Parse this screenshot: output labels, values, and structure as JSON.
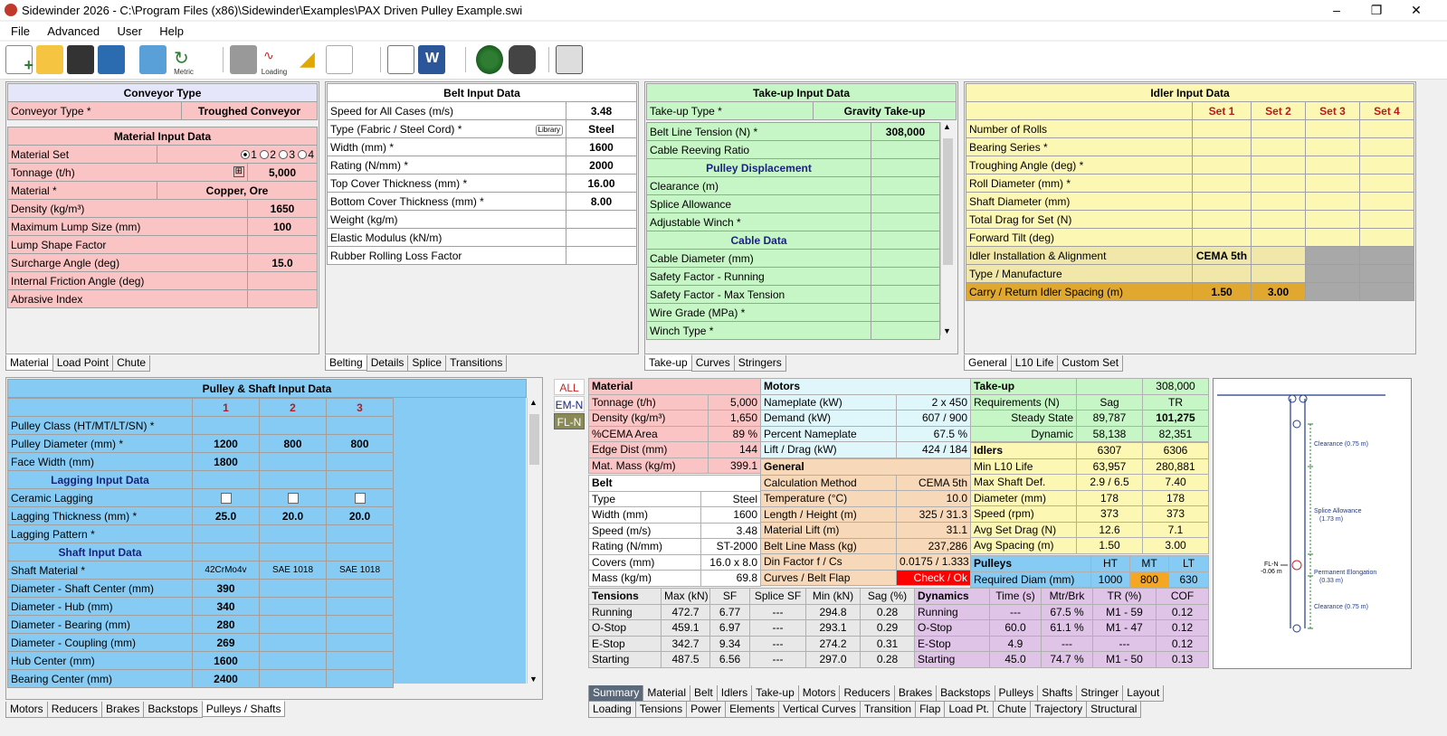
{
  "title": "Sidewinder 2026 - C:\\Program Files (x86)\\Sidewinder\\Examples\\PAX Driven Pulley Example.swi",
  "menu": [
    "File",
    "Advanced",
    "User",
    "Help"
  ],
  "toolbar": {
    "loading_label": "Loading",
    "metric_label": "Metric"
  },
  "conveyor": {
    "header": "Conveyor Type",
    "type_label": "Conveyor Type *",
    "type_value": "Troughed Conveyor"
  },
  "material": {
    "header": "Material Input Data",
    "set_label": "Material Set",
    "sets": [
      "1",
      "2",
      "3",
      "4"
    ],
    "tonnage_label": "Tonnage (t/h)",
    "tonnage": "5,000",
    "material_label": "Material *",
    "material_value": "Copper, Ore",
    "rows": [
      {
        "label": "Density (kg/m³)",
        "value": "1650"
      },
      {
        "label": "Maximum Lump Size (mm)",
        "value": "100"
      },
      {
        "label": "Lump Shape Factor",
        "value": ""
      },
      {
        "label": "Surcharge Angle (deg)",
        "value": "15.0"
      },
      {
        "label": "Internal Friction Angle (deg)",
        "value": ""
      },
      {
        "label": "Abrasive Index",
        "value": ""
      }
    ],
    "tabs": [
      "Material",
      "Load Point",
      "Chute"
    ]
  },
  "belt": {
    "header": "Belt Input Data",
    "speed_label": "Speed for All Cases (m/s)",
    "speed": "3.48",
    "type_label": "Type (Fabric / Steel Cord) *",
    "library_label": "Library",
    "type_value": "Steel",
    "rows": [
      {
        "label": "Width (mm) *",
        "value": "1600"
      },
      {
        "label": "Rating (N/mm) *",
        "value": "2000"
      },
      {
        "label": "Top Cover Thickness (mm) *",
        "value": "16.00"
      },
      {
        "label": "Bottom Cover Thickness (mm) *",
        "value": "8.00"
      },
      {
        "label": "Weight (kg/m)",
        "value": ""
      },
      {
        "label": "Elastic Modulus (kN/m)",
        "value": ""
      },
      {
        "label": "Rubber Rolling Loss Factor",
        "value": ""
      }
    ],
    "tabs": [
      "Belting",
      "Details",
      "Splice",
      "Transitions"
    ]
  },
  "takeup": {
    "header": "Take-up Input Data",
    "type_label": "Take-up Type *",
    "type_value": "Gravity Take-up",
    "rows": [
      {
        "label": "Belt Line Tension (N) *",
        "value": "308,000",
        "sub": false
      },
      {
        "label": "Cable Reeving Ratio",
        "value": "",
        "sub": false
      },
      {
        "label": "Pulley Displacement",
        "value": "",
        "sub": true
      },
      {
        "label": "Clearance (m)",
        "value": "",
        "sub": false
      },
      {
        "label": "Splice Allowance",
        "value": "",
        "sub": false
      },
      {
        "label": "Adjustable Winch *",
        "value": "",
        "sub": false
      },
      {
        "label": "Cable Data",
        "value": "",
        "sub": true
      },
      {
        "label": "Cable Diameter (mm)",
        "value": "",
        "sub": false
      },
      {
        "label": "Safety Factor - Running",
        "value": "",
        "sub": false
      },
      {
        "label": "Safety Factor - Max Tension",
        "value": "",
        "sub": false
      },
      {
        "label": "Wire Grade (MPa) *",
        "value": "",
        "sub": false
      },
      {
        "label": "Winch Type *",
        "value": "",
        "sub": false
      }
    ],
    "tabs": [
      "Take-up",
      "Curves",
      "Stringers"
    ]
  },
  "idler": {
    "header": "Idler Input Data",
    "sets": [
      "Set 1",
      "Set 2",
      "Set 3",
      "Set 4"
    ],
    "rows": [
      "Number of Rolls",
      "Bearing Series *",
      "Troughing Angle (deg) *",
      "Roll Diameter (mm) *",
      "Shaft Diameter (mm)",
      "Total Drag for Set (N)",
      "Forward Tilt (deg)"
    ],
    "install_label": "Idler Installation & Alignment",
    "install_value": "CEMA 5th",
    "type_label": "Type / Manufacture",
    "spacing_label": "Carry / Return Idler Spacing (m)",
    "spacing": [
      "1.50",
      "3.00"
    ],
    "tabs": [
      "General",
      "L10 Life",
      "Custom Set"
    ]
  },
  "pulley": {
    "header": "Pulley & Shaft Input Data",
    "cols": [
      "1",
      "2",
      "3"
    ],
    "rows": [
      {
        "label": "Pulley Class (HT/MT/LT/SN) *",
        "v": [
          "",
          "",
          ""
        ],
        "sub": false
      },
      {
        "label": "Pulley Diameter (mm) *",
        "v": [
          "1200",
          "800",
          "800"
        ],
        "sub": false
      },
      {
        "label": "Face Width (mm)",
        "v": [
          "1800",
          "",
          ""
        ],
        "sub": false
      },
      {
        "label": "Lagging Input Data",
        "v": [],
        "sub": true
      },
      {
        "label": "Ceramic Lagging",
        "v": [
          "chk",
          "chk",
          "chk"
        ],
        "sub": false
      },
      {
        "label": "Lagging Thickness (mm) *",
        "v": [
          "25.0",
          "20.0",
          "20.0"
        ],
        "sub": false
      },
      {
        "label": "Lagging Pattern *",
        "v": [
          "",
          "",
          ""
        ],
        "sub": false
      },
      {
        "label": "Shaft Input Data",
        "v": [],
        "sub": true
      },
      {
        "label": "Shaft Material *",
        "v": [
          "42CrMo4v",
          "SAE 1018",
          "SAE 1018"
        ],
        "sub": false,
        "small": true
      },
      {
        "label": "Diameter - Shaft Center (mm)",
        "v": [
          "390",
          "",
          ""
        ],
        "sub": false
      },
      {
        "label": "Diameter - Hub (mm)",
        "v": [
          "340",
          "",
          ""
        ],
        "sub": false
      },
      {
        "label": "Diameter - Bearing (mm)",
        "v": [
          "280",
          "",
          ""
        ],
        "sub": false
      },
      {
        "label": "Diameter - Coupling (mm)",
        "v": [
          "269",
          "",
          ""
        ],
        "sub": false
      },
      {
        "label": "Hub Center (mm)",
        "v": [
          "1600",
          "",
          ""
        ],
        "sub": false
      },
      {
        "label": "Bearing Center (mm)",
        "v": [
          "2400",
          "",
          ""
        ],
        "sub": false
      }
    ],
    "tabs": [
      "Motors",
      "Reducers",
      "Brakes",
      "Backstops",
      "Pulleys / Shafts"
    ]
  },
  "modes": [
    "ALL",
    "EM-N",
    "FL-N"
  ],
  "summary": {
    "material": {
      "header": "Material",
      "rows": [
        [
          "Tonnage (t/h)",
          "5,000"
        ],
        [
          "Density (kg/m³)",
          "1,650"
        ],
        [
          "%CEMA Area",
          "89 %"
        ],
        [
          "Edge Dist (mm)",
          "144"
        ],
        [
          "Mat. Mass (kg/m)",
          "399.1"
        ]
      ]
    },
    "belt": {
      "header": "Belt",
      "rows": [
        [
          "Type",
          "Steel"
        ],
        [
          "Width (mm)",
          "1600"
        ],
        [
          "Speed (m/s)",
          "3.48"
        ],
        [
          "Rating (N/mm)",
          "ST-2000"
        ],
        [
          "Covers (mm)",
          "16.0 x 8.0"
        ],
        [
          "Mass (kg/m)",
          "69.8"
        ]
      ]
    },
    "motors": {
      "header": "Motors",
      "rows": [
        [
          "Nameplate (kW)",
          "2 x 450"
        ],
        [
          "Demand (kW)",
          "607 / 900"
        ],
        [
          "Percent Nameplate",
          "67.5 %"
        ],
        [
          "Lift / Drag (kW)",
          "424 / 184"
        ]
      ]
    },
    "general": {
      "header": "General",
      "rows": [
        [
          "Calculation Method",
          "CEMA 5th"
        ],
        [
          "Temperature (°C)",
          "10.0"
        ],
        [
          "Length / Height (m)",
          "325 / 31.3"
        ],
        [
          "Material Lift (m)",
          "31.1"
        ],
        [
          "Belt Line Mass (kg)",
          "237,286"
        ],
        [
          "Din Factor f / Cs",
          "0.0175 / 1.333"
        ],
        [
          "Curves / Belt Flap",
          "Check / Ok"
        ]
      ]
    },
    "takeup": {
      "header": "Take-up",
      "value": "308,000",
      "req_label": "Requirements (N)",
      "cols": [
        "Sag",
        "TR"
      ],
      "rows": [
        [
          "Steady State",
          "89,787",
          "101,275"
        ],
        [
          "Dynamic",
          "58,138",
          "82,351"
        ]
      ]
    },
    "idlers": {
      "header": "Idlers",
      "cols": [
        "6307",
        "6306"
      ],
      "rows": [
        [
          "Min L10 Life",
          "63,957",
          "280,881"
        ],
        [
          "Max Shaft Def.",
          "2.9 / 6.5",
          "7.40"
        ],
        [
          "Diameter (mm)",
          "178",
          "178"
        ],
        [
          "Speed (rpm)",
          "373",
          "373"
        ],
        [
          "Avg Set Drag (N)",
          "12.6",
          "7.1"
        ],
        [
          "Avg Spacing (m)",
          "1.50",
          "3.00"
        ]
      ]
    },
    "pulleys": {
      "header": "Pulleys",
      "cols": [
        "HT",
        "MT",
        "LT"
      ],
      "label": "Required Diam (mm)",
      "values": [
        "1000",
        "800",
        "630"
      ]
    },
    "tensions": {
      "header": "Tensions",
      "cols": [
        "Max (kN)",
        "SF",
        "Splice SF",
        "Min (kN)",
        "Sag (%)"
      ],
      "rows": [
        [
          "Running",
          "472.7",
          "6.77",
          "---",
          "294.8",
          "0.28"
        ],
        [
          "O-Stop",
          "459.1",
          "6.97",
          "---",
          "293.1",
          "0.29"
        ],
        [
          "E-Stop",
          "342.7",
          "9.34",
          "---",
          "274.2",
          "0.31"
        ],
        [
          "Starting",
          "487.5",
          "6.56",
          "---",
          "297.0",
          "0.28"
        ]
      ]
    },
    "dynamics": {
      "header": "Dynamics",
      "cols": [
        "Time (s)",
        "Mtr/Brk",
        "TR (%)",
        "COF"
      ],
      "rows": [
        [
          "Running",
          "---",
          "67.5 %",
          "M1 - 59",
          "0.12"
        ],
        [
          "O-Stop",
          "60.0",
          "61.1 %",
          "M1 - 47",
          "0.12"
        ],
        [
          "E-Stop",
          "4.9",
          "---",
          "---",
          "0.12"
        ],
        [
          "Starting",
          "45.0",
          "74.7 %",
          "M1 - 50",
          "0.13"
        ]
      ]
    }
  },
  "diagram": {
    "clearance1": "Clearance (0.75 m)",
    "splice": "Splice Allowance",
    "splice_val": "(1.73 m)",
    "flnote": "FL-N",
    "flval": "-0.06 m",
    "elong": "Permanent Elongation",
    "elong_val": "(0.33 m)",
    "clearance2": "Clearance (0.75 m)"
  },
  "bottom_tabs_row1": [
    "Summary",
    "Material",
    "Belt",
    "Idlers",
    "Take-up",
    "Motors",
    "Reducers",
    "Brakes",
    "Backstops",
    "Pulleys",
    "Shafts",
    "Stringer",
    "Layout"
  ],
  "bottom_tabs_row2": [
    "Loading",
    "Tensions",
    "Power",
    "Elements",
    "Vertical Curves",
    "Transition",
    "Flap",
    "Load Pt.",
    "Chute",
    "Trajectory",
    "Structural"
  ],
  "colors": {
    "pink": "#fbc4c4",
    "green": "#c6f5c6",
    "yellow": "#fdf7b4",
    "blue": "#86cbf3",
    "orange": "#f7d8b8",
    "purple": "#e0c4e8"
  }
}
